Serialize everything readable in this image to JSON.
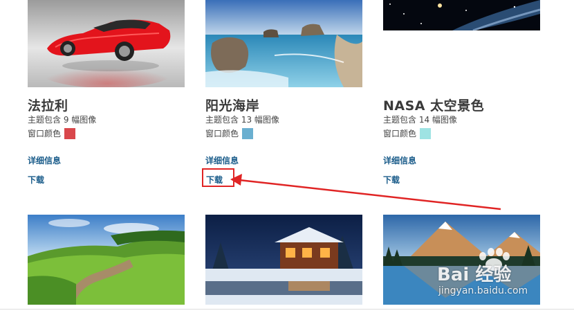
{
  "themes": [
    {
      "title": "法拉利",
      "image_count": "主题包含 9 幅图像",
      "window_color_label": "窗口颜色",
      "window_color": "#d9474b",
      "details_link": "详细信息",
      "download_link": "下载"
    },
    {
      "title": "阳光海岸",
      "image_count": "主题包含 13 幅图像",
      "window_color_label": "窗口颜色",
      "window_color": "#6aafd0",
      "details_link": "详细信息",
      "download_link": "下载"
    },
    {
      "title": "NASA 太空景色",
      "image_count": "主题包含 14 幅图像",
      "window_color_label": "窗口颜色",
      "window_color": "#9ee3e3",
      "details_link": "详细信息",
      "download_link": "下载"
    }
  ],
  "annotation": {
    "highlight_color": "#e02424"
  },
  "watermark": {
    "brand": "Bai 经验",
    "url": "jingyan.baidu.com"
  }
}
